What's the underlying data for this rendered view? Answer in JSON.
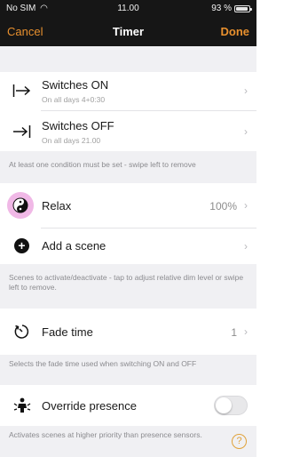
{
  "status_bar": {
    "carrier": "No SIM",
    "time": "11.00",
    "battery": "93 %",
    "battery_level": 0.93
  },
  "nav": {
    "cancel": "Cancel",
    "title": "Timer",
    "done": "Done"
  },
  "switches_on": {
    "title": "Switches ON",
    "subtitle": "On all days 4+0:30",
    "icon": "arrow-to-bar-right-icon"
  },
  "switches_off": {
    "title": "Switches OFF",
    "subtitle": "On all days 21.00",
    "icon": "arrow-bar-right-icon"
  },
  "condition_note": "At least one condition must be set - swipe left to remove",
  "scene_relax": {
    "label": "Relax",
    "value": "100%"
  },
  "add_scene": {
    "label": "Add a scene"
  },
  "scenes_note": "Scenes to activate/deactivate - tap to adjust relative dim level or swipe left to remove.",
  "fade": {
    "label": "Fade time",
    "value": "1"
  },
  "fade_note": "Selects the fade time used when switching ON and OFF",
  "override": {
    "label": "Override presence",
    "enabled": false
  },
  "override_note": "Activates scenes at higher priority than presence sensors.",
  "colors": {
    "accent": "#e8902e",
    "header_bg": "#161616",
    "section_bg": "#f0f0f3",
    "relax_badge": "#f0b8e6"
  }
}
